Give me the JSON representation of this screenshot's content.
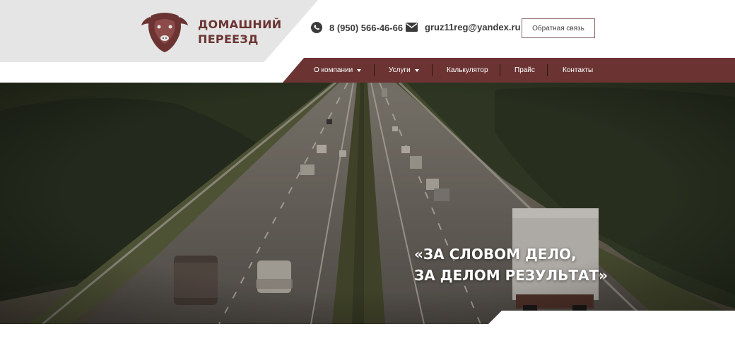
{
  "brand": {
    "name_line1": "ДОМАШНИЙ",
    "name_line2": "ПЕРЕЕЗД",
    "logo_icon": "bull-head-icon"
  },
  "contacts": {
    "phone": "8 (950) 566-46-66",
    "phone_icon": "phone-icon",
    "email": "gruz11reg@yandex.ru",
    "email_icon": "envelope-icon"
  },
  "header": {
    "feedback_label": "Обратная связь"
  },
  "nav": {
    "items": [
      {
        "label": "О компании",
        "dropdown": true
      },
      {
        "label": "Услуги",
        "dropdown": true
      },
      {
        "label": "Калькулятор",
        "dropdown": false
      },
      {
        "label": "Прайс",
        "dropdown": false
      },
      {
        "label": "Контакты",
        "dropdown": false
      }
    ]
  },
  "hero": {
    "slogan_line1": "«ЗА СЛОВОМ ДЕЛО,",
    "slogan_line2": "ЗА ДЕЛОМ РЕЗУЛЬТАТ»"
  },
  "colors": {
    "brand": "#6b3433",
    "logo_bg": "#e5e5e5",
    "text_dark": "#3a3a3a"
  }
}
